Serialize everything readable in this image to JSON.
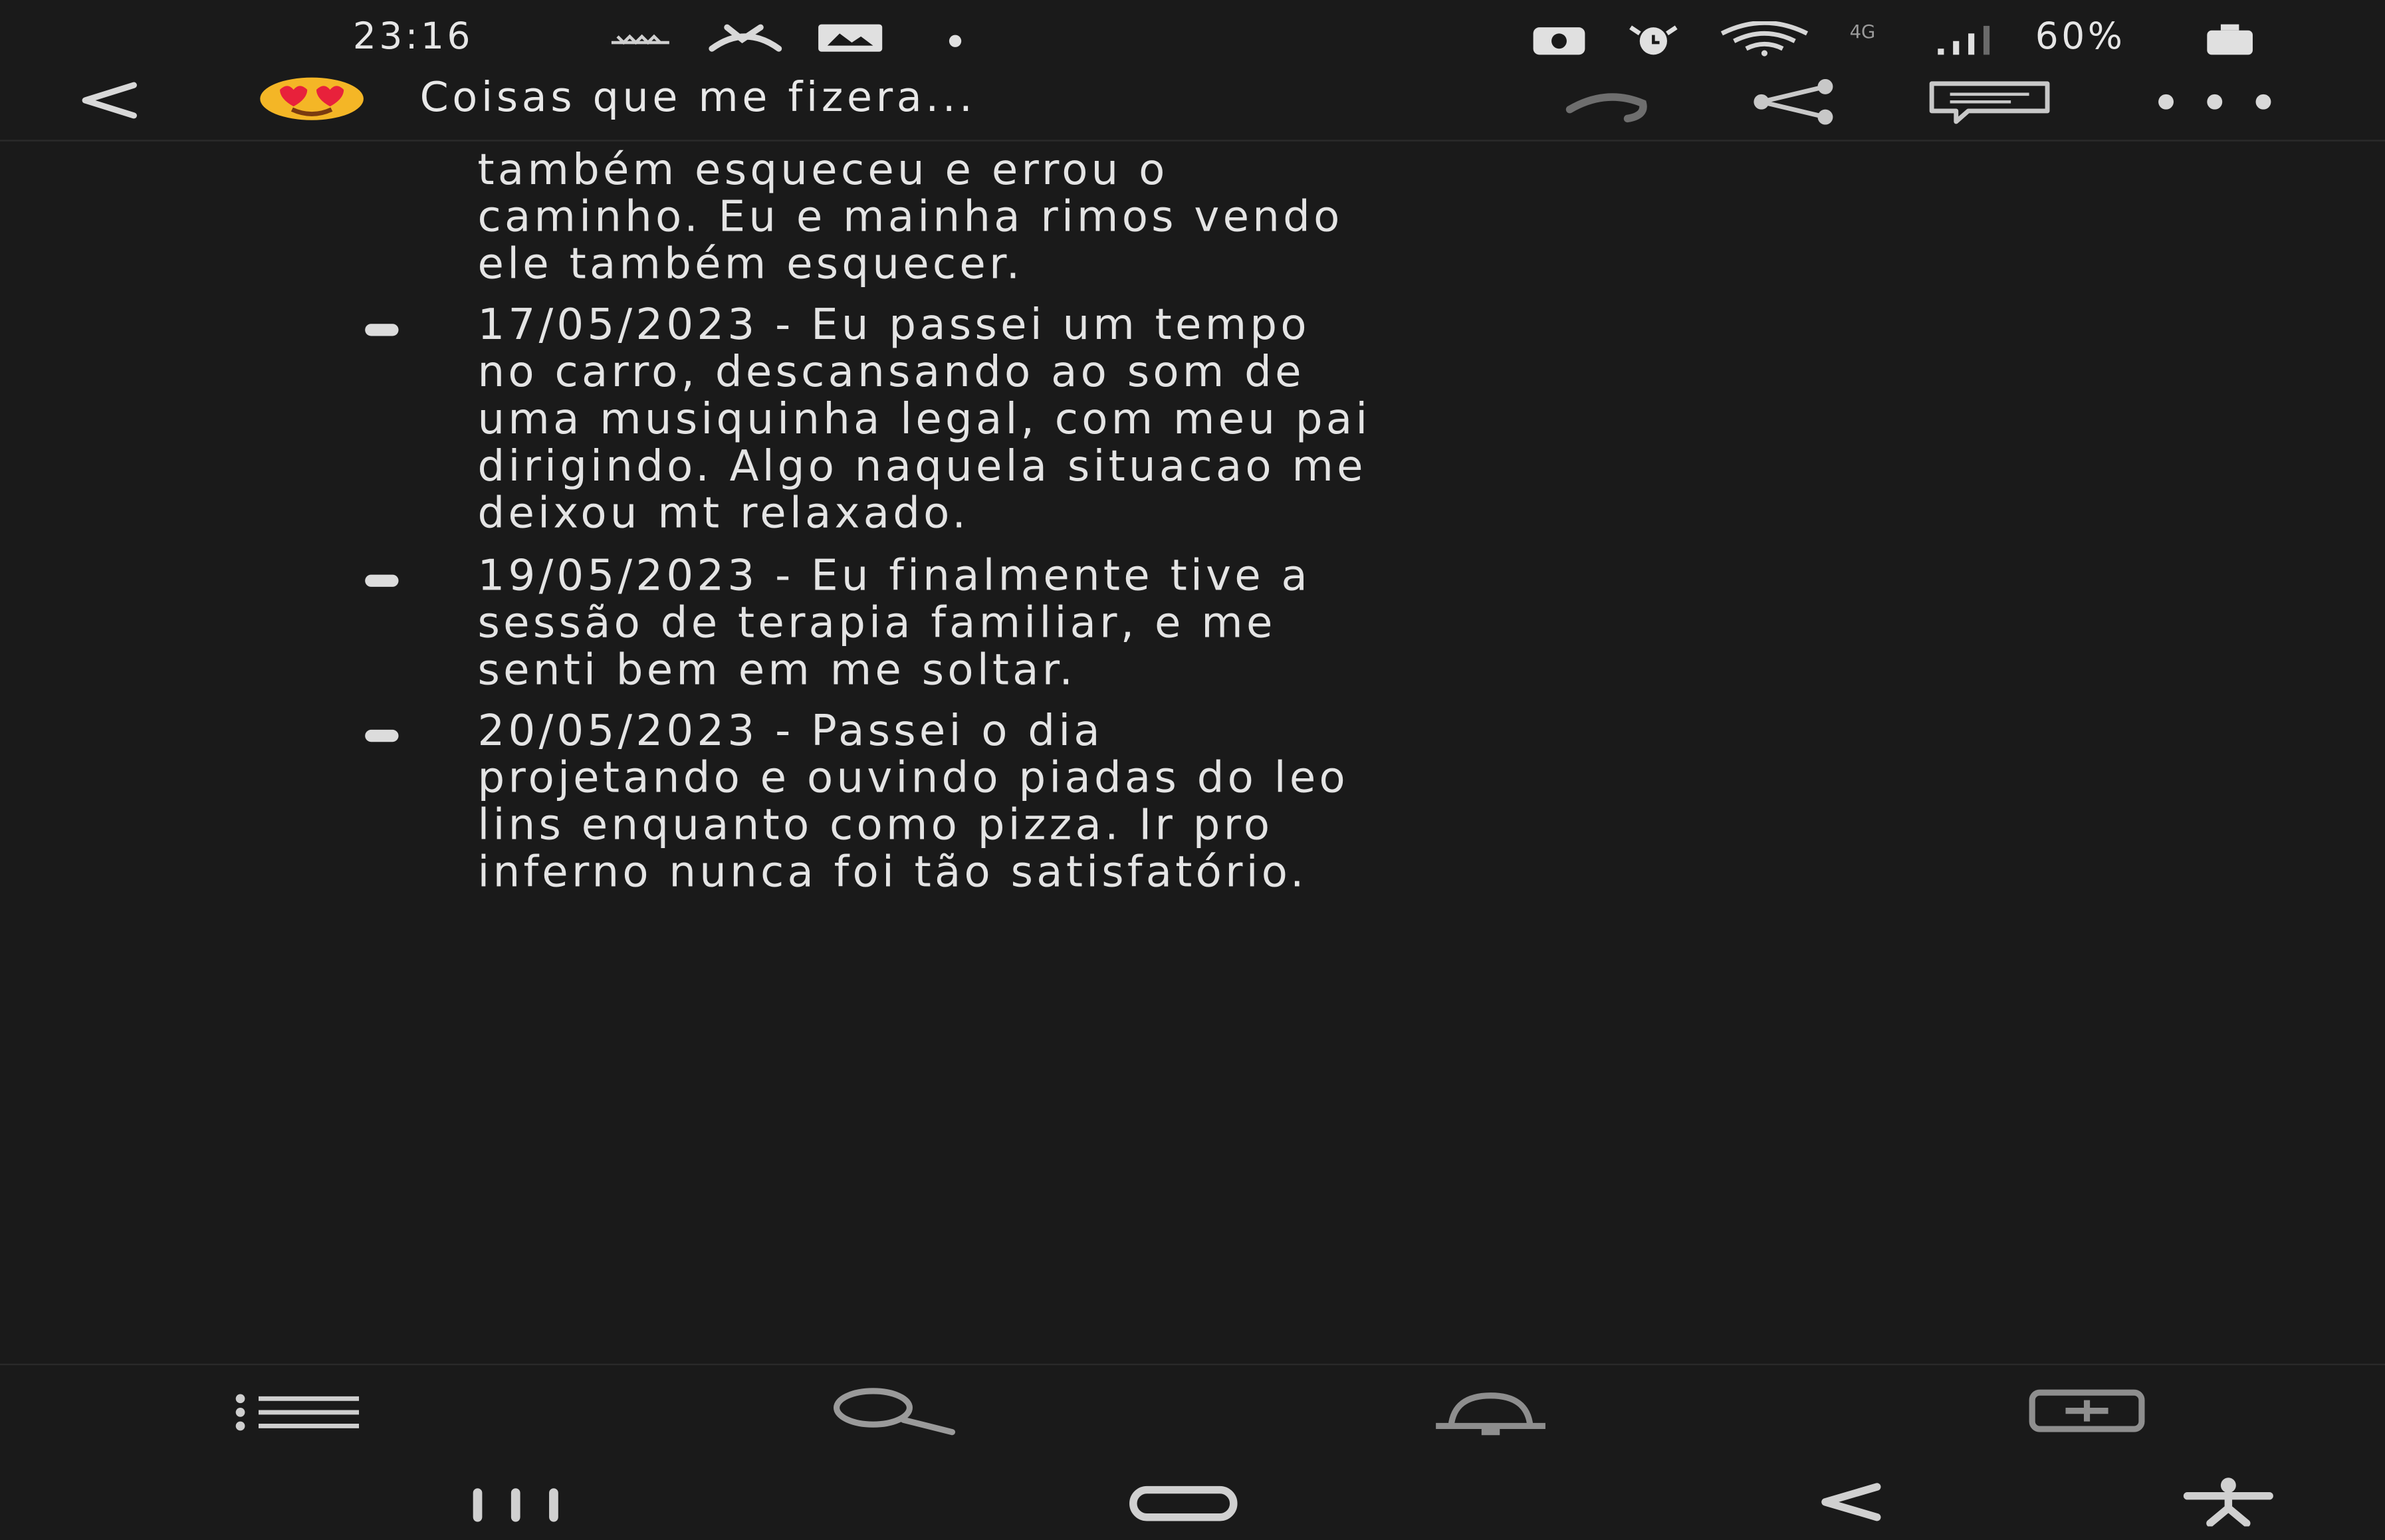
{
  "status_bar": {
    "time": "23:16",
    "battery": "60%",
    "network_label": "4G",
    "icons": [
      "weather-icon",
      "missed-call-icon",
      "gallery-icon",
      "dot-icon",
      "camera-icon",
      "alarm-icon",
      "wifi-icon",
      "signal-icon",
      "battery-icon"
    ]
  },
  "app_bar": {
    "back_icon": "back-arrow-icon",
    "emoji_icon": "heart-eyes-emoji-icon",
    "title": "Coisas que me fizera...",
    "actions": [
      "sync-icon",
      "share-icon",
      "comment-icon",
      "more-icon"
    ]
  },
  "note": {
    "fragment_lines": [
      "também esqueceu e errou o",
      "caminho. Eu e mainha rimos vendo",
      "ele também esquecer."
    ],
    "entries": [
      {
        "lines": [
          "17/05/2023 - Eu passei um tempo",
          "no carro, descansando ao som de",
          "uma musiquinha legal, com meu pai",
          "dirigindo. Algo naquela situacao me",
          "deixou mt relaxado."
        ]
      },
      {
        "lines": [
          "19/05/2023 - Eu finalmente tive a",
          "sessão de terapia familiar, e me",
          "senti bem em me soltar."
        ]
      },
      {
        "lines": [
          "20/05/2023 - Passei o dia",
          "projetando e ouvindo piadas do leo",
          "lins enquanto como pizza. Ir pro",
          "inferno nunca foi tão satisfatório."
        ]
      }
    ]
  },
  "toolbar": {
    "buttons": [
      "list-format-icon",
      "search-icon",
      "reminder-bell-icon",
      "insert-icon"
    ]
  },
  "nav_bar": {
    "buttons": [
      "recent-apps-icon",
      "home-icon",
      "back-icon",
      "accessibility-icon"
    ]
  },
  "colors": {
    "background": "#1a1a1a",
    "text": "#e4e4e4",
    "icon": "#9a9a9a"
  }
}
